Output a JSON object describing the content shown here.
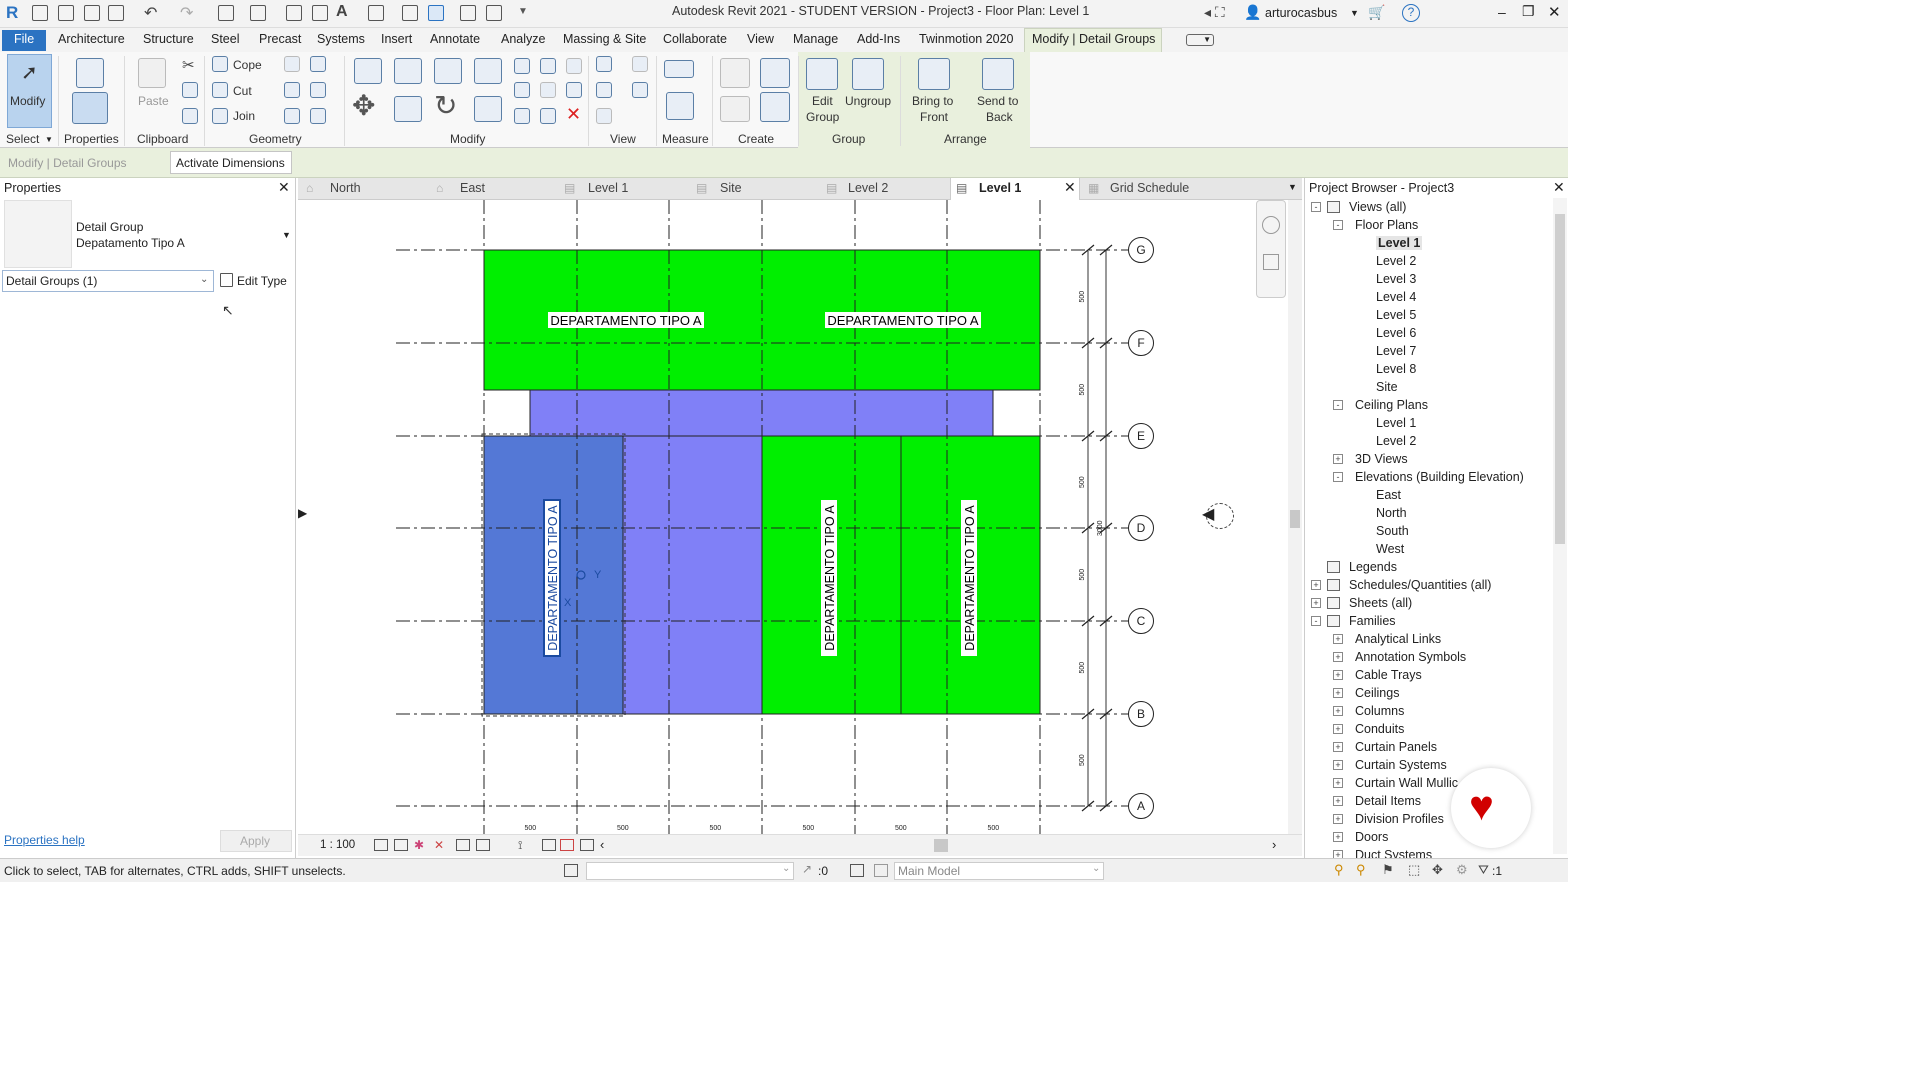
{
  "app": {
    "title": "Autodesk Revit 2021 - STUDENT VERSION - Project3 - Floor Plan: Level 1",
    "user": "arturocasbus"
  },
  "ribbon_tabs": [
    "File",
    "Architecture",
    "Structure",
    "Steel",
    "Precast",
    "Systems",
    "Insert",
    "Annotate",
    "Analyze",
    "Massing & Site",
    "Collaborate",
    "View",
    "Manage",
    "Add-Ins",
    "Twinmotion 2020",
    "Modify | Detail Groups"
  ],
  "ribbon": {
    "modify": "Modify",
    "paste": "Paste",
    "cope": "Cope",
    "cut": "Cut",
    "join": "Join",
    "edit_group": [
      "Edit",
      "Group"
    ],
    "ungroup": "Ungroup",
    "bring_front": [
      "Bring to",
      "Front"
    ],
    "send_back": [
      "Send to",
      "Back"
    ],
    "panels": [
      "Select",
      "Properties",
      "Clipboard",
      "Geometry",
      "Modify",
      "View",
      "Measure",
      "Create",
      "Group",
      "Arrange"
    ]
  },
  "options_bar": {
    "context": "Modify | Detail Groups",
    "button": "Activate Dimensions"
  },
  "properties": {
    "title": "Properties",
    "type_line1": "Detail Group",
    "type_line2": "Depatamento Tipo A",
    "selector": "Detail Groups (1)",
    "edit_type": "Edit Type",
    "help": "Properties help",
    "apply": "Apply"
  },
  "view_tabs": [
    "North",
    "East",
    "Level 1",
    "Site",
    "Level 2",
    "Level 1",
    "Grid Schedule"
  ],
  "canvas": {
    "room_label": "DEPARTAMENTO TIPO A",
    "grids": [
      "G",
      "F",
      "E",
      "D",
      "C",
      "B",
      "A"
    ],
    "dim_small": "500",
    "dim_total": "3000",
    "local_x": "X",
    "local_y": "Y"
  },
  "view_bar": {
    "scale": "1 : 100"
  },
  "browser": {
    "title": "Project Browser - Project3",
    "items": [
      {
        "label": "Views (all)",
        "level": 0,
        "toggle": "-",
        "icon": true
      },
      {
        "label": "Floor Plans",
        "level": 1,
        "toggle": "-"
      },
      {
        "label": "Level 1",
        "level": 2,
        "bold": true
      },
      {
        "label": "Level 2",
        "level": 2
      },
      {
        "label": "Level 3",
        "level": 2
      },
      {
        "label": "Level 4",
        "level": 2
      },
      {
        "label": "Level 5",
        "level": 2
      },
      {
        "label": "Level 6",
        "level": 2
      },
      {
        "label": "Level 7",
        "level": 2
      },
      {
        "label": "Level 8",
        "level": 2
      },
      {
        "label": "Site",
        "level": 2
      },
      {
        "label": "Ceiling Plans",
        "level": 1,
        "toggle": "-"
      },
      {
        "label": "Level 1",
        "level": 2
      },
      {
        "label": "Level 2",
        "level": 2
      },
      {
        "label": "3D Views",
        "level": 1,
        "toggle": "+"
      },
      {
        "label": "Elevations (Building Elevation)",
        "level": 1,
        "toggle": "-"
      },
      {
        "label": "East",
        "level": 2
      },
      {
        "label": "North",
        "level": 2
      },
      {
        "label": "South",
        "level": 2
      },
      {
        "label": "West",
        "level": 2
      },
      {
        "label": "Legends",
        "level": 0,
        "icon": true
      },
      {
        "label": "Schedules/Quantities (all)",
        "level": 0,
        "toggle": "+",
        "icon": true
      },
      {
        "label": "Sheets (all)",
        "level": 0,
        "toggle": "+",
        "icon": true
      },
      {
        "label": "Families",
        "level": 0,
        "toggle": "-",
        "icon": true
      },
      {
        "label": "Analytical Links",
        "level": 1,
        "toggle": "+"
      },
      {
        "label": "Annotation Symbols",
        "level": 1,
        "toggle": "+"
      },
      {
        "label": "Cable Trays",
        "level": 1,
        "toggle": "+"
      },
      {
        "label": "Ceilings",
        "level": 1,
        "toggle": "+"
      },
      {
        "label": "Columns",
        "level": 1,
        "toggle": "+"
      },
      {
        "label": "Conduits",
        "level": 1,
        "toggle": "+"
      },
      {
        "label": "Curtain Panels",
        "level": 1,
        "toggle": "+"
      },
      {
        "label": "Curtain Systems",
        "level": 1,
        "toggle": "+"
      },
      {
        "label": "Curtain Wall Mullic",
        "level": 1,
        "toggle": "+"
      },
      {
        "label": "Detail Items",
        "level": 1,
        "toggle": "+"
      },
      {
        "label": "Division Profiles",
        "level": 1,
        "toggle": "+"
      },
      {
        "label": "Doors",
        "level": 1,
        "toggle": "+"
      },
      {
        "label": "Duct Systems",
        "level": 1,
        "toggle": "+"
      }
    ]
  },
  "status": {
    "message": "Click to select, TAB for alternates, CTRL adds, SHIFT unselects.",
    "count": ":0",
    "model": "Main Model",
    "filter": ":1"
  },
  "colors": {
    "green": "#00ef00",
    "purple": "#8080f7",
    "blue": "#5478d6",
    "accent": "#2b73c2"
  }
}
